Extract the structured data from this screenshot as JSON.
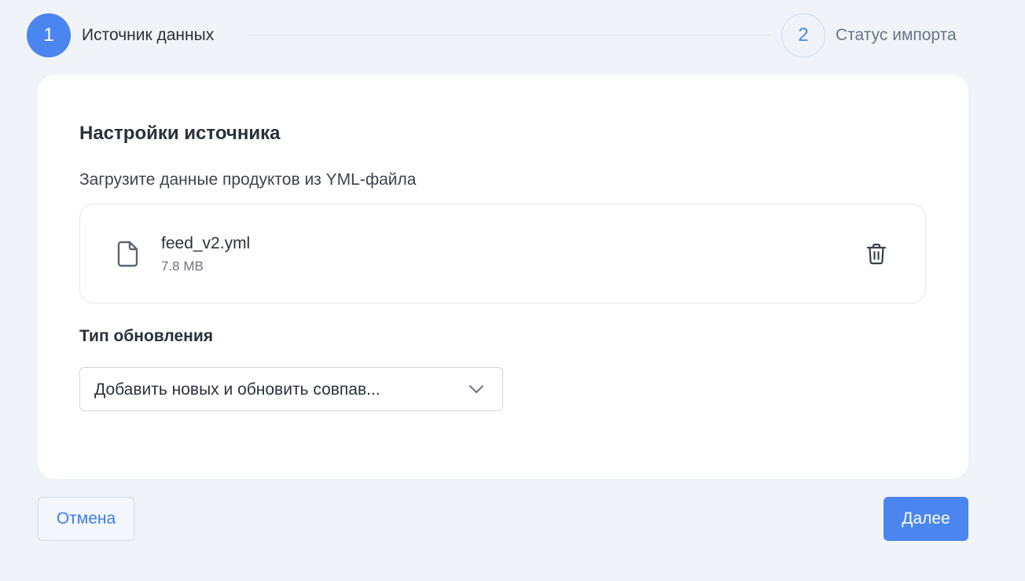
{
  "stepper": {
    "steps": [
      {
        "number": "1",
        "label": "Источник данных",
        "state": "active"
      },
      {
        "number": "2",
        "label": "Статус импорта",
        "state": "inactive"
      }
    ]
  },
  "source_settings": {
    "title": "Настройки источника",
    "subtitle": "Загрузите данные продуктов из YML-файла",
    "file": {
      "icon": "file-icon",
      "name": "feed_v2.yml",
      "size": "7.8 MB",
      "delete_icon": "trash-icon"
    },
    "update_type": {
      "label": "Тип обновления",
      "selected": "Добавить новых и обновить совпав...",
      "chevron_icon": "chevron-down-icon"
    }
  },
  "footer": {
    "cancel_label": "Отмена",
    "next_label": "Далее"
  },
  "colors": {
    "background": "#f0f4f9",
    "accent": "#4a85f0",
    "card": "#ffffff",
    "text_primary": "#2b313b",
    "text_muted": "#6b7483"
  }
}
